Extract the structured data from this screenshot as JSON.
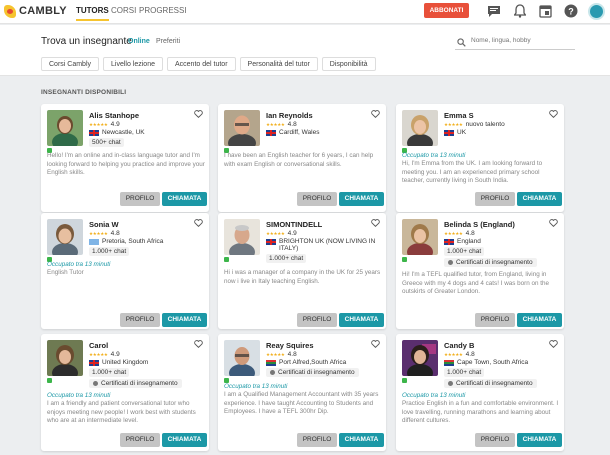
{
  "brand": {
    "name": "CAMBLY",
    "accent": "#f6c42f",
    "teal": "#1c98a6",
    "orange": "#e8503a"
  },
  "nav": {
    "tabs": [
      "TUTORS",
      "CORSI",
      "PROGRESSI"
    ],
    "subscribe_label": "ABBONATI"
  },
  "header": {
    "title": "Trova un insegnante",
    "online_label": "Online",
    "favorites_label": "Preferiti",
    "search_placeholder": "Nome, lingua, hobby",
    "filters": [
      "Corsi Cambly",
      "Livello lezione",
      "Accento del tutor",
      "Personalità del tutor",
      "Disponibilità"
    ]
  },
  "section_title": "INSEGNANTI DISPONIBILI",
  "tutors": [
    {
      "name": "Alis Stanhope",
      "stars": "★★★★★",
      "rating": "4.9",
      "flag": "uk",
      "location": "Newcastle, UK",
      "chats": "500+ chat",
      "certified": "",
      "availability": "",
      "bio": "Hello! I'm an online and in-class language tutor and I'm looking forward to helping you practice and improve your English skills.",
      "profile_label": "PROFILO",
      "call_label": "CHIAMATA"
    },
    {
      "name": "Ian Reynolds",
      "stars": "★★★★★",
      "rating": "4.8",
      "flag": "uk",
      "location": "Cardiff, Wales",
      "chats": "",
      "certified": "",
      "availability": "",
      "bio": "I have been an English teacher for 6 years, I can help with exam English or conversational skills.",
      "profile_label": "PROFILO",
      "call_label": "CHIAMATA"
    },
    {
      "name": "Emma S",
      "stars": "★★★★★",
      "rating": "nuovo talento",
      "flag": "uk",
      "location": "UK",
      "chats": "",
      "certified": "",
      "availability": "Occupato tra 13 minuti",
      "bio": "Hi, I'm Emma from the UK. I am looking forward to meeting you. I am an experienced primary school teacher, currently living in South India.",
      "profile_label": "PROFILO",
      "call_label": "CHIAMATA"
    },
    {
      "name": "Sonia W",
      "stars": "★★★★★",
      "rating": "4.8",
      "flag": "un",
      "location": "Pretoria, South Africa",
      "chats": "1.000+ chat",
      "certified": "",
      "availability": "Occupato tra 13 minuti",
      "bio": "English Tutor",
      "profile_label": "PROFILO",
      "call_label": "CHIAMATA"
    },
    {
      "name": "SIMONTINDELL",
      "stars": "★★★★★",
      "rating": "4.9",
      "flag": "uk",
      "location": "BRIGHTON UK (NOW LIVING IN ITALY)",
      "chats": "1.000+ chat",
      "certified": "",
      "availability": "",
      "bio": "Hi i was a manager of a company in the UK for 25 years now i live in Italy teaching English.",
      "profile_label": "PROFILO",
      "call_label": "CHIAMATA"
    },
    {
      "name": "Belinda S (England)",
      "stars": "★★★★★",
      "rating": "4.8",
      "flag": "uk",
      "location": "England",
      "chats": "1.000+ chat",
      "certified": "Certificati di insegnamento",
      "availability": "",
      "bio": "Hi! I'm a TEFL qualified tutor, from England, living in Greece with my 4 dogs and 4 cats! I was born on the outskirts of Greater London.",
      "profile_label": "PROFILO",
      "call_label": "CHIAMATA"
    },
    {
      "name": "Carol",
      "stars": "★★★★★",
      "rating": "4.9",
      "flag": "uk",
      "location": "United Kingdom",
      "chats": "1.000+ chat",
      "certified": "Certificati di insegnamento",
      "availability": "Occupato tra 13 minuti",
      "bio": "I am a friendly and patient conversational tutor who enjoys meeting new people! I work best with students who are at an intermediate level.",
      "profile_label": "PROFILO",
      "call_label": "CHIAMATA"
    },
    {
      "name": "Reay Squires",
      "stars": "★★★★★",
      "rating": "4.8",
      "flag": "za",
      "location": "Port Alfred,South Africa",
      "chats": "",
      "certified": "Certificati di insegnamento",
      "availability": "Occupato tra 13 minuti",
      "bio": "I am a Qualified Management Accountant with 35 years experience. I have taught Accounting to Students and Employees. I have a TEFL 300hr Dip.",
      "profile_label": "PROFILO",
      "call_label": "CHIAMATA"
    },
    {
      "name": "Candy B",
      "stars": "★★★★★",
      "rating": "4.8",
      "flag": "za",
      "location": "Cape Town, South Africa",
      "chats": "1.000+ chat",
      "certified": "Certificati di insegnamento",
      "availability": "Occupato tra 13 minuti",
      "bio": "Practice English in a fun and comfortable environment. I love travelling, running marathons and learning about different cultures.",
      "profile_label": "PROFILO",
      "call_label": "CHIAMATA"
    }
  ]
}
